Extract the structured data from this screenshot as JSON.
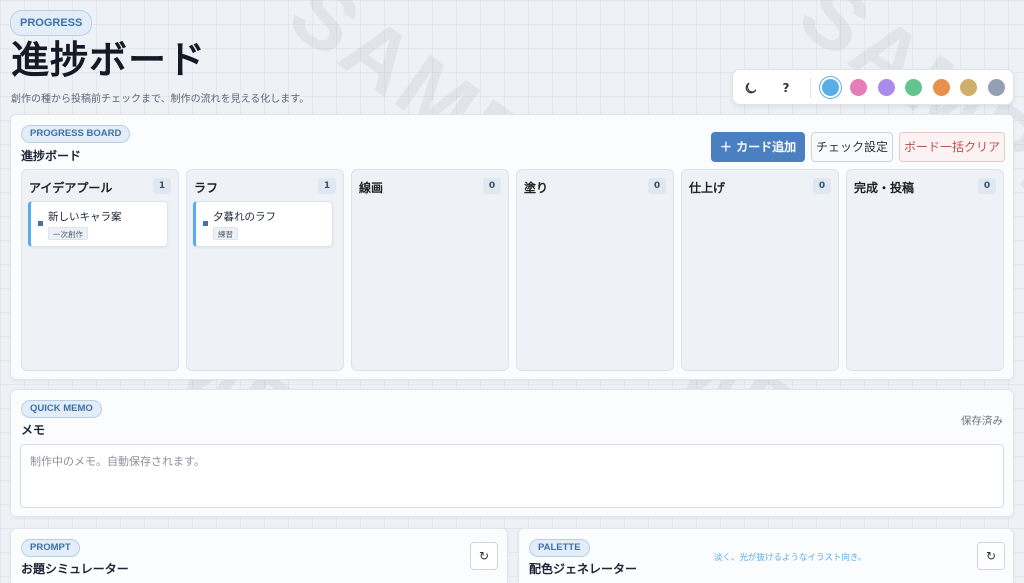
{
  "header": {
    "tag": "PROGRESS",
    "title": "進捗ボード",
    "subtitle": "創作の種から投稿前チェックまで、制作の流れを見える化します。"
  },
  "toolbar": {
    "moon_icon": "moon-icon",
    "help_label": "?",
    "swatches": [
      {
        "name": "blue",
        "color": "#5aaee8",
        "active": true
      },
      {
        "name": "pink",
        "color": "#e57db7"
      },
      {
        "name": "purple",
        "color": "#a98bea"
      },
      {
        "name": "green",
        "color": "#62c48f"
      },
      {
        "name": "orange",
        "color": "#e8914a"
      },
      {
        "name": "khaki",
        "color": "#d1ae6a"
      },
      {
        "name": "slate",
        "color": "#959fb3"
      }
    ]
  },
  "board": {
    "tag": "PROGRESS BOARD",
    "title": "進捗ボード",
    "add_label": "＋ カード追加",
    "check_label": "チェック設定",
    "clear_label": "ボード一括クリア",
    "columns": [
      {
        "title": "アイデアプール",
        "count": "1",
        "cards": [
          {
            "title": "新しいキャラ案",
            "tag": "一次創作"
          }
        ]
      },
      {
        "title": "ラフ",
        "count": "1",
        "cards": [
          {
            "title": "夕暮れのラフ",
            "tag": "練習"
          }
        ]
      },
      {
        "title": "線画",
        "count": "0",
        "cards": []
      },
      {
        "title": "塗り",
        "count": "0",
        "cards": []
      },
      {
        "title": "仕上げ",
        "count": "0",
        "cards": []
      },
      {
        "title": "完成・投稿",
        "count": "0",
        "cards": []
      }
    ]
  },
  "memo": {
    "tag": "QUICK MEMO",
    "title": "メモ",
    "status": "保存済み",
    "placeholder": "制作中のメモ。自動保存されます。"
  },
  "prompt": {
    "tag": "PROMPT",
    "title": "お題シミュレーター",
    "refresh_label": "↻"
  },
  "palette": {
    "tag": "PALETTE",
    "title": "配色ジェネレーター",
    "hint": "淡く、光が抜けるようなイラスト向き。",
    "refresh_label": "↻"
  },
  "watermark": "SAMPLE",
  "colors": {
    "accent": "#4a7fc1",
    "danger": "#c0504f"
  }
}
